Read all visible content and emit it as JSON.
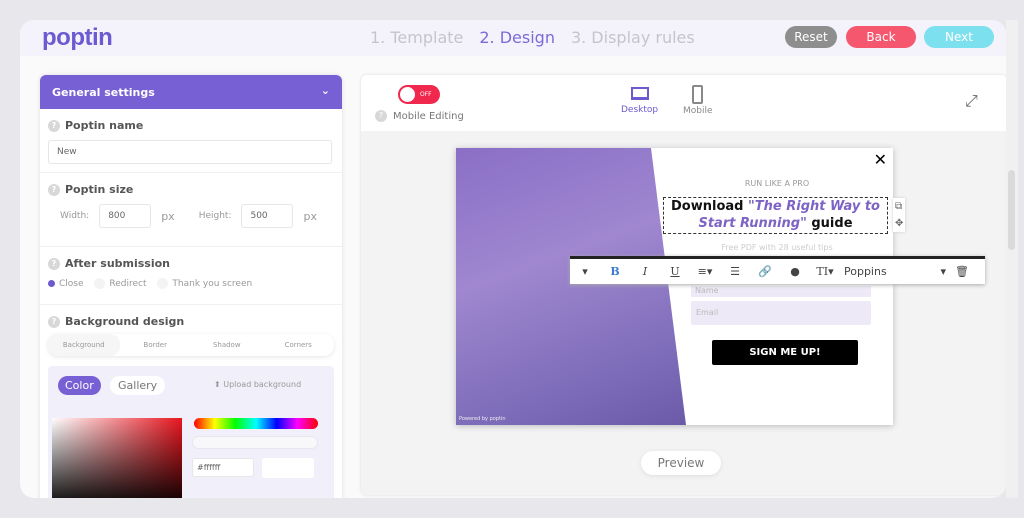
{
  "header": {
    "logo": "poptin",
    "steps": [
      "1. Template",
      "2. Design",
      "3. Display rules"
    ],
    "active_step": 1,
    "reset": "Reset",
    "back": "Back",
    "next": "Next"
  },
  "colors": {
    "brand": "#775fd4",
    "reset": "#8e8e8e",
    "back": "#f5586e",
    "next": "#7de0ee"
  },
  "sidebar": {
    "header": "General settings",
    "name_title": "Poptin name",
    "name_value": "New",
    "size_title": "Poptin size",
    "width_label": "Width:",
    "width_value": "800",
    "height_label": "Height:",
    "height_value": "500",
    "px": "px",
    "after_title": "After submission",
    "after_options": [
      "Close",
      "Redirect",
      "Thank you screen"
    ],
    "after_selected": "Close",
    "bg_title": "Background design",
    "bg_tabs": [
      "Background",
      "Border",
      "Shadow",
      "Corners"
    ],
    "color_tab": "Color",
    "gallery_tab": "Gallery",
    "upload": "Upload background",
    "hex": "#ffffff"
  },
  "editor": {
    "toggle": "OFF",
    "mobile_editing": "Mobile Editing",
    "desktop": "Desktop",
    "mobile": "Mobile",
    "preview": "Preview"
  },
  "popup": {
    "kicker": "RUN LIKE A PRO",
    "title_a": "Download ",
    "title_b": "\"The Right Way to Start Running\"",
    "title_c": " guide",
    "subtitle": "Free PDF with 28 useful tips",
    "name_placeholder": "Name",
    "email_placeholder": "Email",
    "cta": "SIGN ME UP!",
    "powered": "Powered by poptin"
  },
  "text_toolbar": {
    "font": "Poppins"
  }
}
